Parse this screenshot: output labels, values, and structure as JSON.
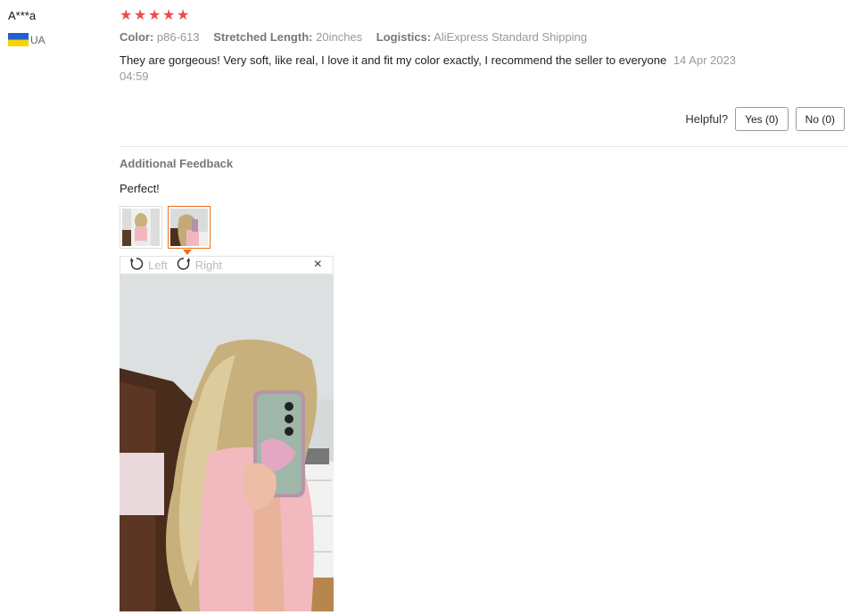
{
  "review": {
    "user_name": "A***a",
    "country_code": "UA",
    "flag_colors": {
      "top": "#1f5fcf",
      "bottom": "#f7d300"
    },
    "rating": 5,
    "attributes": [
      {
        "key": "Color:",
        "value": "p86-613"
      },
      {
        "key": "Stretched Length:",
        "value": "20inches"
      },
      {
        "key": "Logistics:",
        "value": "AliExpress Standard Shipping"
      }
    ],
    "text": "They are gorgeous! Very soft, like real, I love it and fit my color exactly, I recommend the seller to everyone",
    "date": "14 Apr 2023",
    "time": "04:59"
  },
  "helpful": {
    "label": "Helpful?",
    "yes_label": "Yes (0)",
    "no_label": "No (0)"
  },
  "additional": {
    "title": "Additional Feedback",
    "text": "Perfect!"
  },
  "viewer": {
    "rotate_left_label": "Left",
    "rotate_right_label": "Right",
    "close_symbol": "×",
    "active_thumbnail": 2
  },
  "colors": {
    "star": "#f04a4a",
    "active_border": "#e9701b"
  }
}
